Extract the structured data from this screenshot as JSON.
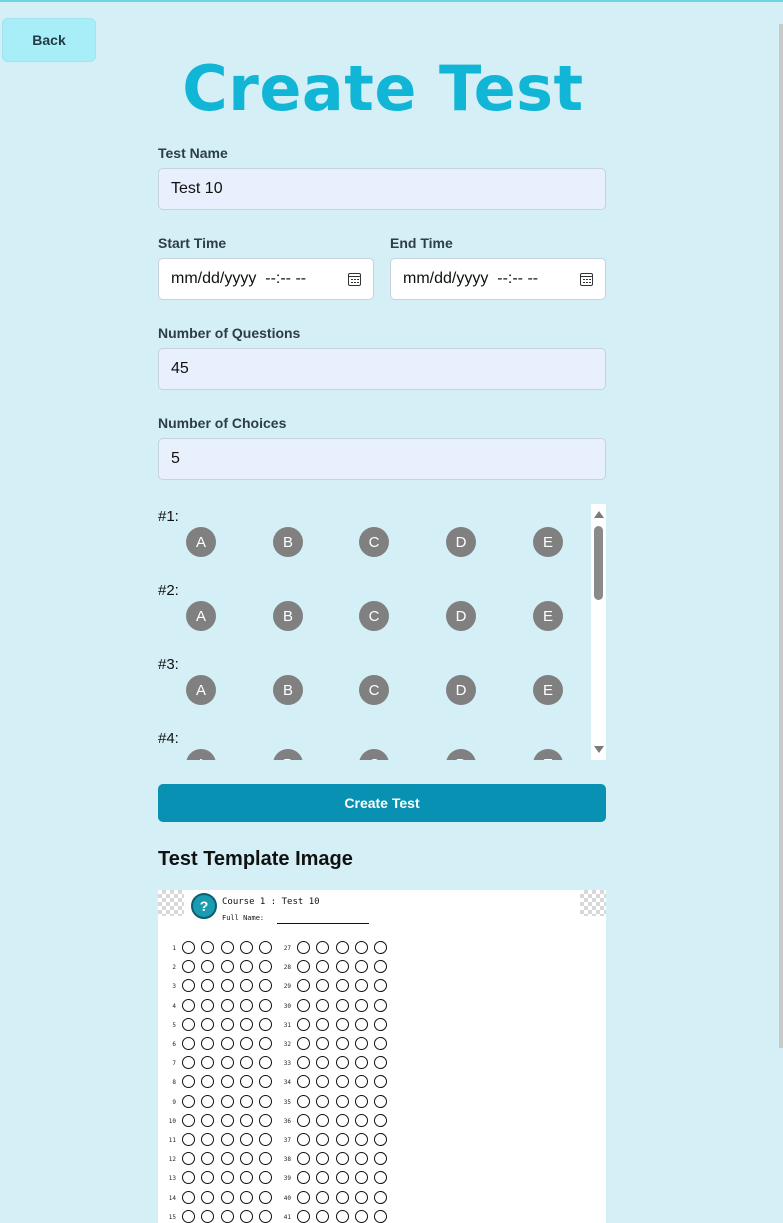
{
  "back_label": "Back",
  "page_title": "Create Test",
  "form": {
    "test_name": {
      "label": "Test Name",
      "value": "Test 10"
    },
    "start_time": {
      "label": "Start Time",
      "value": "mm/dd/yyyy  --:-- --"
    },
    "end_time": {
      "label": "End Time",
      "value": "mm/dd/yyyy  --:-- --"
    },
    "num_questions": {
      "label": "Number of Questions",
      "value": "45"
    },
    "num_choices": {
      "label": "Number of Choices",
      "value": "5"
    }
  },
  "questions": [
    {
      "label": "#1:",
      "choices": [
        "A",
        "B",
        "C",
        "D",
        "E"
      ]
    },
    {
      "label": "#2:",
      "choices": [
        "A",
        "B",
        "C",
        "D",
        "E"
      ]
    },
    {
      "label": "#3:",
      "choices": [
        "A",
        "B",
        "C",
        "D",
        "E"
      ]
    },
    {
      "label": "#4:",
      "choices": [
        "A",
        "B",
        "C",
        "D",
        "E"
      ]
    }
  ],
  "create_button_label": "Create Test",
  "template": {
    "title": "Test Template Image",
    "course_line": "Course 1 : Test 10",
    "full_name_label": "Full Name:",
    "logo_glyph": "?",
    "left_numbers": [
      "1",
      "2",
      "3",
      "4",
      "5",
      "6",
      "7",
      "8",
      "9",
      "10",
      "11",
      "12",
      "13",
      "14",
      "15"
    ],
    "right_numbers": [
      "27",
      "28",
      "29",
      "30",
      "31",
      "32",
      "33",
      "34",
      "35",
      "36",
      "37",
      "38",
      "39",
      "40",
      "41"
    ]
  },
  "colors": {
    "accent": "#0891b2",
    "title": "#11b5d5",
    "background": "#d4eff6",
    "choice": "#808080"
  }
}
